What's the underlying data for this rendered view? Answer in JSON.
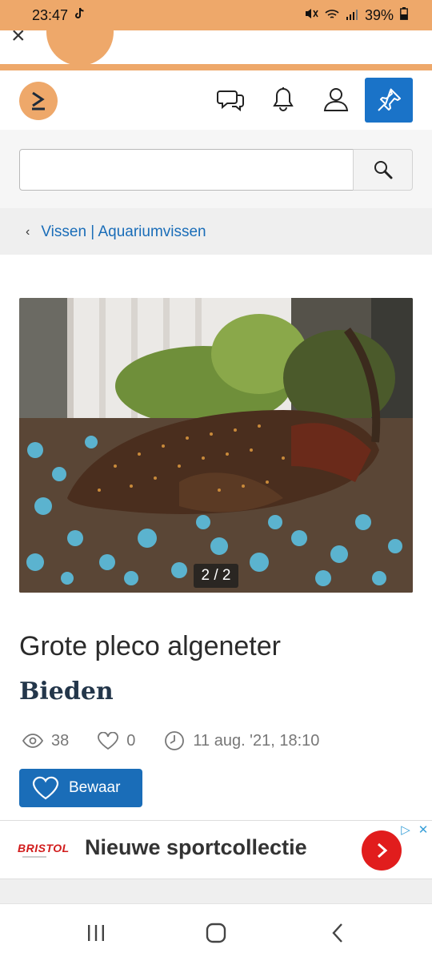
{
  "status_bar": {
    "time": "23:47",
    "battery": "39%",
    "icons": [
      "tiktok-icon",
      "mute-icon",
      "wifi-icon",
      "signal-icon",
      "battery-icon"
    ]
  },
  "header": {
    "icons": [
      "logo-icon",
      "messages-icon",
      "notifications-icon",
      "account-icon",
      "place-ad-icon"
    ]
  },
  "search": {
    "value": "",
    "placeholder": ""
  },
  "breadcrumb": {
    "label": "Vissen | Aquariumvissen"
  },
  "listing": {
    "image_counter": "2 / 2",
    "title": "Grote pleco algeneter",
    "price": "Bieden",
    "views": "38",
    "favorites": "0",
    "date": "11 aug. '21, 18:10",
    "save_label": "Bewaar"
  },
  "ad": {
    "brand": "BRISTOL",
    "text": "Nieuwe sportcollectie"
  },
  "colors": {
    "accent_orange": "#eea86a",
    "primary_blue": "#1a6db8",
    "ad_red": "#e11d1d"
  }
}
